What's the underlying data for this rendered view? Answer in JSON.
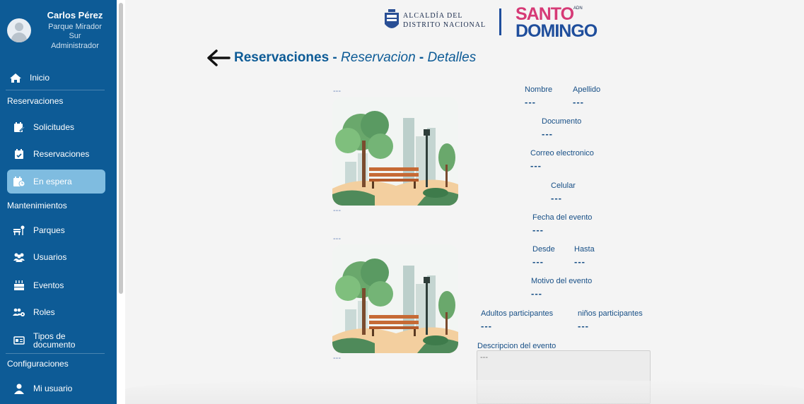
{
  "sidebar": {
    "user": {
      "name": "Carlos Pérez",
      "location_line1": "Parque Mirador",
      "location_line2": "Sur",
      "role": "Administrador"
    },
    "inicio": "Inicio",
    "section_reservaciones": "Reservaciones",
    "solicitudes": "Solicitudes",
    "reservaciones": "Reservaciones",
    "en_espera": "En espera",
    "section_mantenimientos": "Mantenimientos",
    "parques": "Parques",
    "usuarios": "Usuarios",
    "eventos": "Eventos",
    "roles": "Roles",
    "tipos_line1": "Tipos de",
    "tipos_line2": "documento",
    "section_configuraciones": "Configuraciones",
    "mi_usuario": "Mi usuario",
    "accent_color": "#0d5b96",
    "active_color": "#7fbce0"
  },
  "header": {
    "alcaldia_line1": "ALCALDÍA DEL",
    "alcaldia_line2": "DISTRITO NACIONAL",
    "santo": "SANTO",
    "domingo": "DOMINGO",
    "adn": "ADN"
  },
  "title": {
    "part1": "Reservaciones",
    "sep1": " - ",
    "part2": "Reservacion",
    "sep2": " - ",
    "part3": "Detalles"
  },
  "images": {
    "top_caption": "---",
    "top_footer": "---",
    "bottom_caption": "---",
    "bottom_footer": "---"
  },
  "details": {
    "nombre_label": "Nombre",
    "nombre_value": "---",
    "apellido_label": "Apellido",
    "apellido_value": "---",
    "documento_label": "Documento",
    "documento_value": "---",
    "correo_label": "Correo electronico",
    "correo_value": "---",
    "celular_label": "Celular",
    "celular_value": "---",
    "fecha_label": "Fecha del evento",
    "fecha_value": "---",
    "desde_label": "Desde",
    "desde_value": "---",
    "hasta_label": "Hasta",
    "hasta_value": "---",
    "motivo_label": "Motivo del evento",
    "motivo_value": "---",
    "adultos_label": "Adultos participantes",
    "adultos_value": "---",
    "ninos_label": "niños participantes",
    "ninos_value": "---",
    "descripcion_label": "Descripcion del evento",
    "descripcion_value": "---"
  }
}
